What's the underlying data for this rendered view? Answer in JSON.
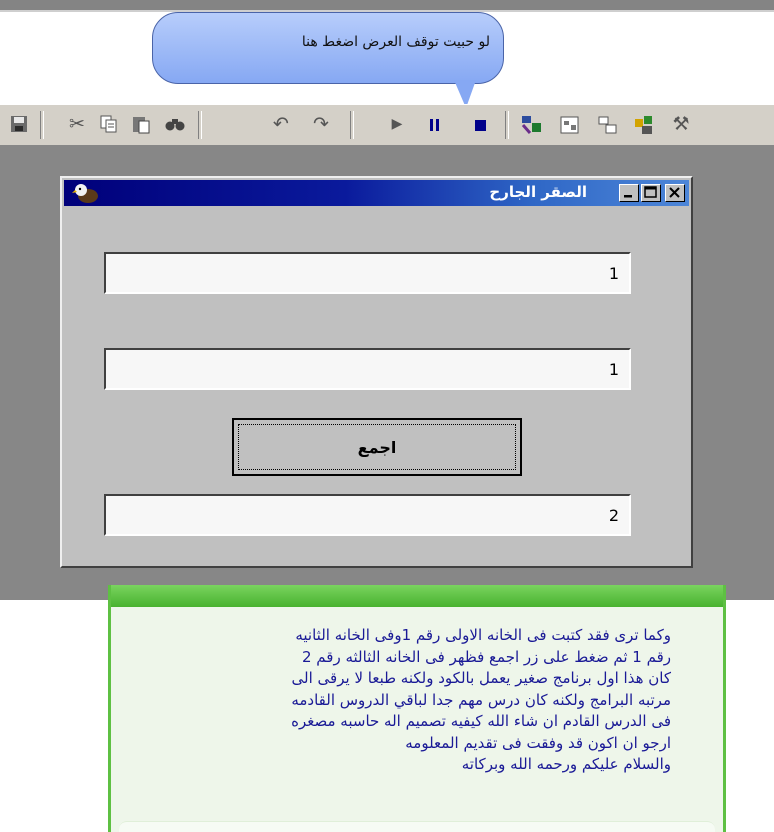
{
  "callout": {
    "text": "لو حبيت توقف العرض اضغط هنا"
  },
  "toolbar": {
    "icons": [
      "save-icon",
      "cut-icon",
      "copy-icon",
      "paste-icon",
      "find-icon",
      "undo-icon",
      "redo-icon",
      "play-icon",
      "pause-icon",
      "stop-icon",
      "project-icon",
      "properties-icon",
      "form-layout-icon",
      "object-browser-icon",
      "toolbox-icon"
    ]
  },
  "window": {
    "title": "الصقر الجارح",
    "field1_value": "1",
    "field2_value": "1",
    "add_button_label": "اجمع",
    "result_value": "2"
  },
  "note": {
    "lines": [
      "وكما ترى فقد كتبت فى الخانه الاولى رقم 1وفى الخانه الثانيه",
      " رقم 1 ثم ضغط على زر اجمع فظهر فى الخانه الثالثه رقم 2",
      "كان هذا اول برنامج صغير يعمل بالكود ولكنه طبعا لا يرقى الى",
      "مرتبه البرامج ولكنه كان درس مهم جدا لباقي الدروس القادمه",
      "فى الدرس القادم ان شاء الله كيفيه تصميم اله حاسبه مصغره",
      "ارجو ان اكون قد وفقت فى تقديم المعلومه ",
      "والسلام عليكم ورحمه الله وبركاته"
    ]
  }
}
